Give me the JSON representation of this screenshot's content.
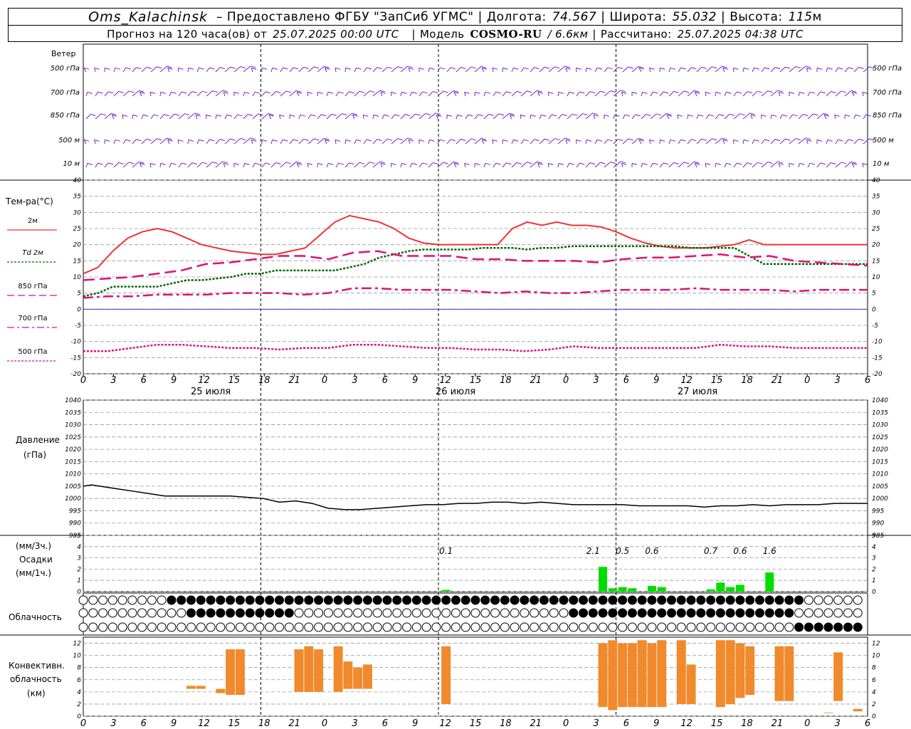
{
  "header": {
    "station": "Oms_Kalachinsk",
    "provider": "– Предоставлено ФГБУ \"ЗапСиб УГМС\"",
    "lon_label": "Долгота:",
    "lon_value": "74.567",
    "lat_label": "Широта:",
    "lat_value": "55.032",
    "alt_label": "Высота:",
    "alt_value": "115",
    "alt_unit": "м",
    "forecast_prefix": "Прогноз на 120 часа(ов) от",
    "forecast_time": "25.07.2025 00:00 UTC",
    "model_label": "Модель",
    "model_name": "COSMO-RU",
    "model_res": "/ 6.6км",
    "calc_label": "Рассчитано:",
    "calc_time": "25.07.2025 04:38 UTC"
  },
  "labels": {
    "wind": "Ветер",
    "wind_levels": [
      "500 гПа",
      "700 гПа",
      "850 гПа",
      "500 м",
      "10 м"
    ],
    "temp_title": "Тем-ра(°C)",
    "legend": [
      {
        "name": "2м",
        "color": "#ee3333",
        "style": "solid"
      },
      {
        "name": "Td 2м",
        "color": "#006600",
        "style": "dotted"
      },
      {
        "name": "850 гПа",
        "color": "#dd1177",
        "style": "dashed"
      },
      {
        "name": "700 гПа",
        "color": "#dd1177",
        "style": "dashdot"
      },
      {
        "name": "500 гПа",
        "color": "#dd1177",
        "style": "dotted"
      }
    ],
    "pressure_title": "Давление",
    "pressure_unit": "(гПа)",
    "precip_unit3": "(мм/3ч.)",
    "precip_title": "Осадки",
    "precip_unit1": "(мм/1ч.)",
    "cloud_title": "Облачность",
    "conv_title1": "Конвективн.",
    "conv_title2": "облачность",
    "conv_unit": "(км)",
    "days": [
      "25 июля",
      "26 июля",
      "27 июля"
    ]
  },
  "colors": {
    "t2m": "#ee3333",
    "td": "#006600",
    "t850": "#dd1177",
    "t700": "#dd1177",
    "t500": "#dd1177",
    "wind": "#7722cc",
    "pressure": "#000000",
    "precip": "#00dd00",
    "conv": "#f08a2c",
    "zero_line": "#3333cc"
  },
  "chart_data": [
    {
      "type": "line",
      "title": "Тем-ра(°C)",
      "x_hours_ticks": [
        "0",
        "3",
        "6",
        "9",
        "12",
        "15",
        "18",
        "21",
        "0",
        "3",
        "6",
        "9",
        "12",
        "15",
        "18",
        "21",
        "0",
        "3",
        "6",
        "9",
        "12",
        "15",
        "18",
        "21",
        "0",
        "3",
        "6"
      ],
      "ylim": [
        -20,
        40
      ],
      "yticks": [
        -20,
        -15,
        -10,
        -5,
        0,
        5,
        10,
        15,
        20,
        25,
        30,
        35,
        40
      ],
      "series": [
        {
          "name": "2м",
          "x": [
            0,
            2,
            4,
            6,
            8,
            10,
            12,
            14,
            16,
            18,
            20,
            22,
            24,
            26,
            28,
            30,
            32,
            34,
            36,
            38,
            40,
            42,
            44,
            46,
            48,
            50,
            52,
            54,
            56,
            58,
            60,
            62,
            64,
            66,
            68,
            70,
            72,
            74,
            76,
            78,
            80,
            82,
            84,
            86,
            88,
            90,
            92,
            94,
            96,
            98,
            100,
            102,
            104,
            106
          ],
          "y": [
            11,
            13,
            18,
            22,
            24,
            25,
            24,
            22,
            20,
            19,
            18,
            17.5,
            17,
            17,
            18,
            19,
            23,
            27,
            29,
            28,
            27,
            25,
            22,
            20.5,
            20,
            20,
            20,
            20,
            20,
            25,
            27,
            26,
            27,
            26,
            26,
            25.5,
            24,
            22,
            20.5,
            19.5,
            19,
            19,
            19,
            19.5,
            20,
            21.5,
            20,
            20,
            20,
            20,
            20,
            20,
            20,
            20
          ]
        },
        {
          "name": "Td 2м",
          "x": [
            0,
            2,
            4,
            6,
            8,
            10,
            12,
            14,
            16,
            18,
            20,
            22,
            24,
            26,
            28,
            30,
            32,
            34,
            36,
            38,
            40,
            42,
            44,
            46,
            48,
            50,
            52,
            54,
            56,
            58,
            60,
            62,
            64,
            66,
            68,
            70,
            72,
            74,
            76,
            78,
            80,
            82,
            84,
            86,
            88,
            90,
            92,
            94,
            96,
            98,
            100,
            102,
            104,
            106
          ],
          "y": [
            4,
            5,
            7,
            7,
            7,
            7,
            8,
            9,
            9,
            9.5,
            10,
            11,
            11,
            12,
            12,
            12,
            12,
            12,
            13,
            14,
            16,
            17,
            18,
            18.5,
            18.5,
            18.5,
            18.5,
            19,
            19,
            19,
            18.5,
            19,
            19,
            19.5,
            19.5,
            19.5,
            19.5,
            19.5,
            19.5,
            19.5,
            19.5,
            19,
            19,
            19,
            19,
            16.5,
            14,
            14,
            14,
            14,
            14,
            14,
            14,
            14
          ]
        },
        {
          "name": "850 гПа",
          "x": [
            0,
            3,
            6,
            9,
            12,
            15,
            18,
            21,
            24,
            27,
            30,
            33,
            36,
            39,
            42,
            45,
            48,
            51,
            54,
            57,
            60,
            63,
            66,
            69,
            72,
            75,
            78,
            81,
            84,
            87,
            90,
            93,
            96
          ],
          "y": [
            9,
            9.5,
            10,
            11,
            12,
            14,
            14.5,
            15.5,
            16.5,
            16.5,
            15.5,
            17.5,
            18,
            16.5,
            16.5,
            16.5,
            15.5,
            15.5,
            15,
            15,
            15,
            14.5,
            15.5,
            16,
            16,
            16.5,
            17,
            16,
            16.5,
            15,
            14.5,
            14,
            13.5
          ]
        },
        {
          "name": "700 гПа",
          "x": [
            0,
            3,
            6,
            9,
            12,
            15,
            18,
            21,
            24,
            27,
            30,
            33,
            36,
            39,
            42,
            45,
            48,
            51,
            54,
            57,
            60,
            63,
            66,
            69,
            72,
            75,
            78,
            81,
            84,
            87,
            90,
            93,
            96
          ],
          "y": [
            3.5,
            4,
            4,
            4.5,
            4.5,
            4.5,
            5,
            5,
            5,
            4.5,
            5,
            6.5,
            6.5,
            6,
            6,
            6,
            5.5,
            5,
            5.5,
            5,
            5,
            5.5,
            6,
            6,
            6,
            6.5,
            6,
            6,
            6,
            5.5,
            6,
            6,
            6
          ]
        },
        {
          "name": "500 гПа",
          "x": [
            0,
            3,
            6,
            9,
            12,
            15,
            18,
            21,
            24,
            27,
            30,
            33,
            36,
            39,
            42,
            45,
            48,
            51,
            54,
            57,
            60,
            63,
            66,
            69,
            72,
            75,
            78,
            81,
            84,
            87,
            90,
            93,
            96
          ],
          "y": [
            -13,
            -13,
            -12,
            -11,
            -11,
            -11.5,
            -12,
            -12,
            -12.5,
            -12,
            -12,
            -11,
            -11,
            -11.5,
            -12,
            -12,
            -12.5,
            -12.5,
            -13,
            -12.5,
            -11.5,
            -12,
            -12,
            -12,
            -12,
            -12,
            -11,
            -11.5,
            -11.5,
            -12,
            -12,
            -12,
            -12
          ]
        }
      ]
    },
    {
      "type": "line",
      "title": "Давление",
      "ylim": [
        985,
        1040
      ],
      "yticks": [
        985,
        990,
        995,
        1000,
        1005,
        1010,
        1015,
        1020,
        1025,
        1030,
        1035,
        1040
      ],
      "series": [
        {
          "name": "Давление",
          "x": [
            0,
            1,
            2,
            4,
            6,
            8,
            10,
            12,
            14,
            16,
            18,
            20,
            22,
            24,
            26,
            28,
            30,
            32,
            34,
            36,
            38,
            40,
            42,
            44,
            46,
            48,
            50,
            52,
            54,
            56,
            58,
            60,
            62,
            64,
            66,
            68,
            70,
            72,
            74,
            76,
            78,
            80,
            82,
            84,
            86,
            88,
            90,
            92,
            94,
            96
          ],
          "y": [
            1005,
            1005.5,
            1005,
            1004,
            1003,
            1002,
            1001,
            1001,
            1001,
            1001,
            1001,
            1000.5,
            1000,
            998.5,
            999,
            998,
            996,
            995.5,
            995.5,
            996,
            996.5,
            997,
            997.5,
            997.5,
            998,
            998,
            998.5,
            998.5,
            998,
            998.5,
            998,
            997.5,
            997.5,
            997.5,
            997.5,
            997,
            997,
            997,
            997,
            996.5,
            997,
            997,
            997.5,
            997,
            997.5,
            997.5,
            997.5,
            998,
            998,
            998
          ]
        }
      ]
    },
    {
      "type": "bar",
      "title": "Осадки",
      "ylim": [
        0,
        5
      ],
      "yticks": [
        0,
        1,
        2,
        3,
        4,
        5
      ],
      "annotations": [
        {
          "hour": 37,
          "text": "0.1"
        },
        {
          "hour": 52,
          "text": "2.1"
        },
        {
          "hour": 55,
          "text": "0.5"
        },
        {
          "hour": 58,
          "text": "0.6"
        },
        {
          "hour": 64,
          "text": "0.7"
        },
        {
          "hour": 67,
          "text": "0.6"
        },
        {
          "hour": 70,
          "text": "1.6"
        }
      ],
      "bars": [
        {
          "hour": 37,
          "value": 0.15
        },
        {
          "hour": 53,
          "value": 2.2
        },
        {
          "hour": 54,
          "value": 0.3
        },
        {
          "hour": 55,
          "value": 0.4
        },
        {
          "hour": 56,
          "value": 0.3
        },
        {
          "hour": 58,
          "value": 0.5
        },
        {
          "hour": 59,
          "value": 0.4
        },
        {
          "hour": 64,
          "value": 0.2
        },
        {
          "hour": 65,
          "value": 0.8
        },
        {
          "hour": 66,
          "value": 0.4
        },
        {
          "hour": 67,
          "value": 0.6
        },
        {
          "hour": 70,
          "value": 1.7
        }
      ]
    },
    {
      "type": "bar",
      "title": "Конвективн. облачность",
      "ylim": [
        0,
        13
      ],
      "yticks": [
        0,
        2,
        4,
        6,
        8,
        10,
        12
      ],
      "bars": [
        {
          "hour": 11,
          "bottom": 4.5,
          "top": 5
        },
        {
          "hour": 12,
          "bottom": 4.5,
          "top": 5
        },
        {
          "hour": 14,
          "bottom": 3.8,
          "top": 4.5
        },
        {
          "hour": 15,
          "bottom": 3.5,
          "top": 11
        },
        {
          "hour": 16,
          "bottom": 3.5,
          "top": 11
        },
        {
          "hour": 22,
          "bottom": 4,
          "top": 11
        },
        {
          "hour": 23,
          "bottom": 4,
          "top": 11.5
        },
        {
          "hour": 24,
          "bottom": 4,
          "top": 11
        },
        {
          "hour": 26,
          "bottom": 4,
          "top": 11.5
        },
        {
          "hour": 27,
          "bottom": 4.5,
          "top": 9
        },
        {
          "hour": 28,
          "bottom": 4.5,
          "top": 8
        },
        {
          "hour": 29,
          "bottom": 4.5,
          "top": 8.5
        },
        {
          "hour": 37,
          "bottom": 2,
          "top": 11.5
        },
        {
          "hour": 53,
          "bottom": 1.5,
          "top": 12
        },
        {
          "hour": 54,
          "bottom": 1,
          "top": 12.5
        },
        {
          "hour": 55,
          "bottom": 1.5,
          "top": 12
        },
        {
          "hour": 56,
          "bottom": 1.5,
          "top": 12
        },
        {
          "hour": 57,
          "bottom": 1.5,
          "top": 12.5
        },
        {
          "hour": 58,
          "bottom": 1.5,
          "top": 12
        },
        {
          "hour": 59,
          "bottom": 1.5,
          "top": 12.5
        },
        {
          "hour": 61,
          "bottom": 2,
          "top": 12.5
        },
        {
          "hour": 62,
          "bottom": 2,
          "top": 8.5
        },
        {
          "hour": 65,
          "bottom": 1.5,
          "top": 12.5
        },
        {
          "hour": 66,
          "bottom": 2,
          "top": 12.5
        },
        {
          "hour": 67,
          "bottom": 3,
          "top": 12
        },
        {
          "hour": 68,
          "bottom": 3.5,
          "top": 11.5
        },
        {
          "hour": 71,
          "bottom": 2.5,
          "top": 11.5
        },
        {
          "hour": 72,
          "bottom": 2.5,
          "top": 11.5
        },
        {
          "hour": 76,
          "bottom": 0.5,
          "top": 0.6
        },
        {
          "hour": 77,
          "bottom": 2.5,
          "top": 10.5
        },
        {
          "hour": 79,
          "bottom": 0.8,
          "top": 1.2
        }
      ]
    }
  ]
}
